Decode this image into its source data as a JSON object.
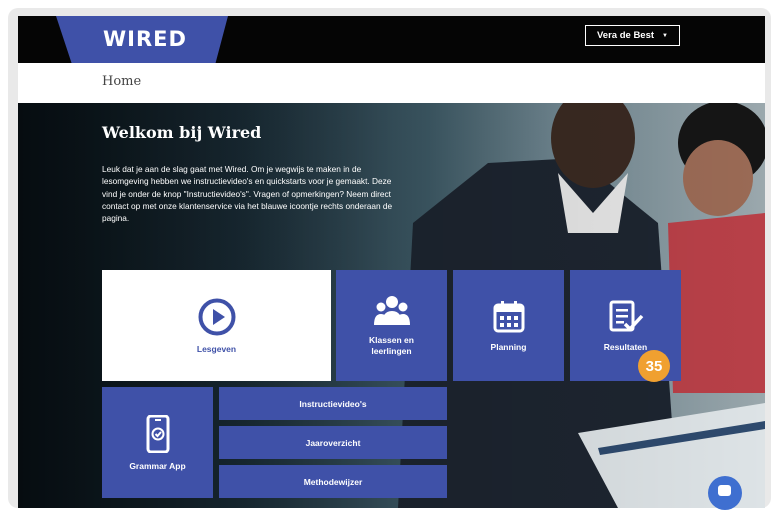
{
  "header": {
    "logo": "WIRED",
    "user_menu": "Vera de Best"
  },
  "breadcrumb": {
    "home": "Home"
  },
  "hero": {
    "title": "Welkom bij Wired",
    "intro": "Leuk dat je aan de slag gaat met Wired. Om je wegwijs te maken in de lesomgeving hebben we instructievideo's en quickstarts voor je gemaakt. Deze vind je onder de knop \"Instructievideo's\". Vragen of opmerkingen? Neem direct contact op met onze klantenservice via het blauwe icoontje rechts onderaan de pagina."
  },
  "tiles": {
    "lesgeven": "Lesgeven",
    "klassen": "Klassen en leerlingen",
    "planning": "Planning",
    "resultaten": "Resultaten",
    "grammar_app": "Grammar App",
    "instructievideos": "Instructievideo's",
    "jaaroverzicht": "Jaaroverzicht",
    "methodewijzer": "Methodewijzer"
  },
  "badge": "35",
  "colors": {
    "brand": "#3f51a8",
    "badge": "#f0a030",
    "chat": "#3f6fd0"
  },
  "icons": [
    "play-icon",
    "people-icon",
    "calendar-icon",
    "checklist-icon",
    "phone-check-icon",
    "chat-icon",
    "caret-down-icon"
  ]
}
